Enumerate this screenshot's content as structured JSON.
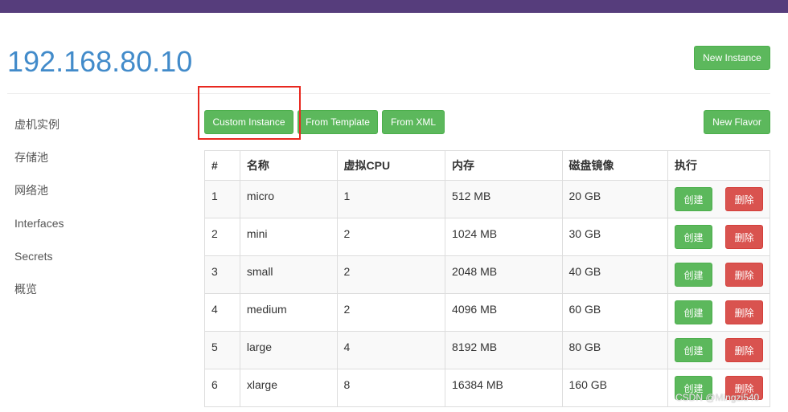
{
  "header": {
    "title": "192.168.80.10"
  },
  "buttons": {
    "new_instance": "New Instance",
    "custom_instance": "Custom Instance",
    "from_template": "From Template",
    "from_xml": "From XML",
    "new_flavor": "New Flavor"
  },
  "sidebar": {
    "items": [
      {
        "label": "虚机实例"
      },
      {
        "label": "存储池"
      },
      {
        "label": "网络池"
      },
      {
        "label": "Interfaces"
      },
      {
        "label": "Secrets"
      },
      {
        "label": "概览"
      }
    ]
  },
  "table": {
    "headers": [
      "#",
      "名称",
      "虚拟CPU",
      "内存",
      "磁盘镜像",
      "执行"
    ],
    "rows": [
      {
        "id": "1",
        "name": "micro",
        "vcpu": "1",
        "memory": "512 MB",
        "disk": "20 GB",
        "create": "创建",
        "delete": "删除"
      },
      {
        "id": "2",
        "name": "mini",
        "vcpu": "2",
        "memory": "1024 MB",
        "disk": "30 GB",
        "create": "创建",
        "delete": "删除"
      },
      {
        "id": "3",
        "name": "small",
        "vcpu": "2",
        "memory": "2048 MB",
        "disk": "40 GB",
        "create": "创建",
        "delete": "删除"
      },
      {
        "id": "4",
        "name": "medium",
        "vcpu": "2",
        "memory": "4096 MB",
        "disk": "60 GB",
        "create": "创建",
        "delete": "删除"
      },
      {
        "id": "5",
        "name": "large",
        "vcpu": "4",
        "memory": "8192 MB",
        "disk": "80 GB",
        "create": "创建",
        "delete": "删除"
      },
      {
        "id": "6",
        "name": "xlarge",
        "vcpu": "8",
        "memory": "16384 MB",
        "disk": "160 GB",
        "create": "创建",
        "delete": "删除"
      }
    ]
  },
  "watermark": "CSDN @Mingzi540",
  "colors": {
    "topbar": "#563d7c",
    "title": "#428bca",
    "success": "#5cb85c",
    "danger": "#d9534f",
    "highlight": "#e8281f"
  }
}
